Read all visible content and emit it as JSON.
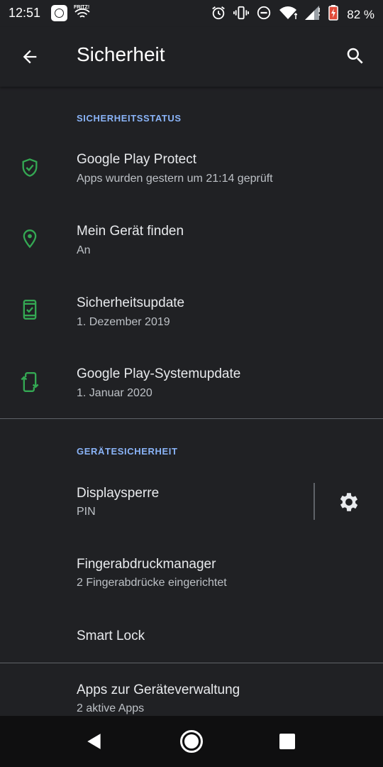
{
  "status_bar": {
    "time": "12:51",
    "network_label": "FRITZ!",
    "battery_percent": "82 %",
    "icons": [
      "notification-icon",
      "wifi-icon",
      "alarm-icon",
      "vibrate-icon",
      "do-not-disturb-icon",
      "wifi-signal-icon",
      "cell-signal-icon",
      "battery-icon"
    ]
  },
  "app_bar": {
    "title": "Sicherheit",
    "back_icon": "arrow-back-icon",
    "search_icon": "search-icon"
  },
  "sections": {
    "status": {
      "header": "SICHERHEITSSTATUS",
      "items": [
        {
          "title": "Google Play Protect",
          "subtitle": "Apps wurden gestern um 21:14 geprüft",
          "icon": "shield-check-icon"
        },
        {
          "title": "Mein Gerät finden",
          "subtitle": "An",
          "icon": "location-pin-icon"
        },
        {
          "title": "Sicherheitsupdate",
          "subtitle": "1. Dezember 2019",
          "icon": "phone-check-icon"
        },
        {
          "title": "Google Play-Systemupdate",
          "subtitle": "1. Januar 2020",
          "icon": "phone-update-icon"
        }
      ]
    },
    "device": {
      "header": "GERÄTESICHERHEIT",
      "items": [
        {
          "title": "Displaysperre",
          "subtitle": "PIN",
          "icon": "gear-icon"
        },
        {
          "title": "Fingerabdruckmanager",
          "subtitle": "2 Fingerabdrücke eingerichtet"
        },
        {
          "title": "Smart Lock",
          "subtitle": ""
        }
      ]
    },
    "admin": {
      "items": [
        {
          "title": "Apps zur Geräteverwaltung",
          "subtitle": "2 aktive Apps"
        }
      ]
    }
  },
  "colors": {
    "background": "#202124",
    "accent": "#8ab4f8",
    "icon_green": "#34a853",
    "divider": "#5f6368"
  },
  "nav_bar": {
    "icons": [
      "back-triangle-icon",
      "home-circle-icon",
      "recents-square-icon"
    ]
  }
}
